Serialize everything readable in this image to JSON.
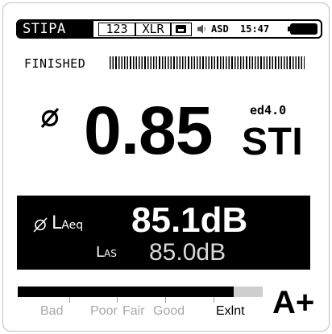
{
  "status_bar": {
    "mode": "STIPA",
    "counter_label": "123",
    "input_label": "XLR",
    "storage_icon": "disk-icon",
    "speaker_icon": "speaker-icon",
    "asd_label": "ASD",
    "time": "15:47",
    "battery_icon": "battery-icon",
    "battery_level": 1.0
  },
  "progress": {
    "label": "FINISHED",
    "fraction": 1.0
  },
  "sti": {
    "average_symbol": "⌀",
    "value": "0.85",
    "edition": "ed4.0",
    "unit": "STI"
  },
  "level": {
    "average_symbol": "⌀",
    "laeq_prefix": "L",
    "laeq_sub": "Aeq",
    "laeq_value": "85.1dB",
    "las_prefix": "L",
    "las_sub": "AS",
    "las_value": "85.0dB"
  },
  "rating_scale": {
    "fill_fraction": 0.88,
    "labels": [
      "Bad",
      "Poor",
      "Fair",
      "Good",
      "Exlnt"
    ],
    "active_index": 4,
    "rating": "A+"
  },
  "colors": {
    "foreground": "#000000",
    "background": "#ffffff",
    "inactive_label": "#a8a8a8",
    "scale_track": "#cfcfcf"
  }
}
